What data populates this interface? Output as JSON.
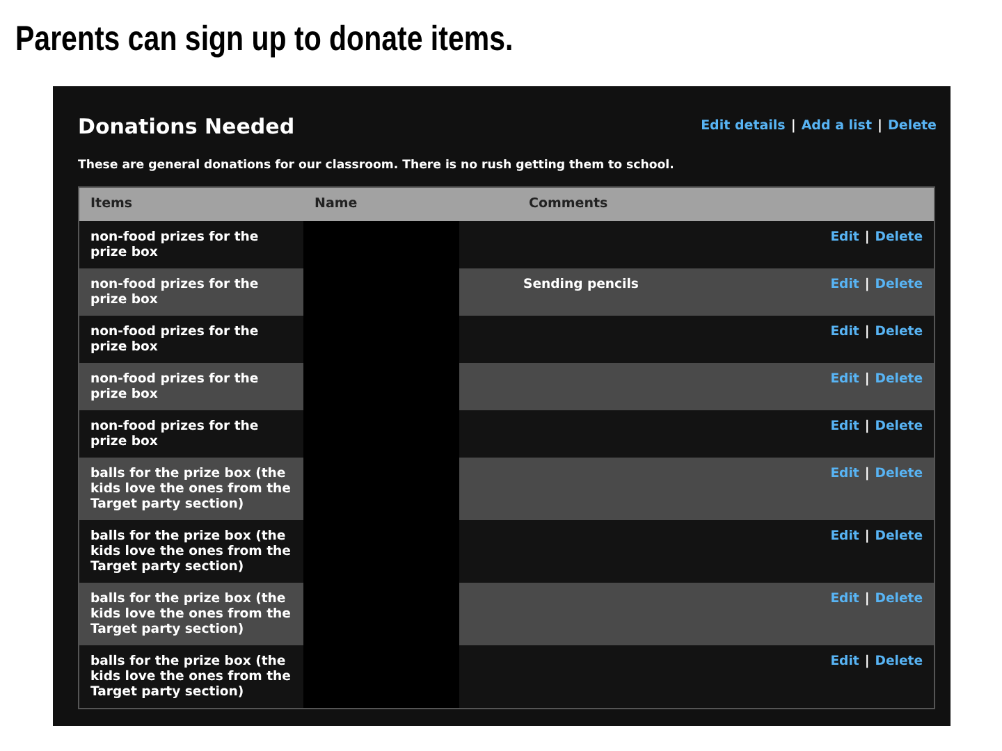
{
  "slide_title": "Parents can sign up to donate items.",
  "panel": {
    "title": "Donations Needed",
    "links": [
      {
        "kind": "link",
        "text": "Edit details"
      },
      {
        "kind": "separator",
        "text": "|"
      },
      {
        "kind": "link",
        "text": "Add a list"
      },
      {
        "kind": "separator",
        "text": "|"
      },
      {
        "kind": "link",
        "text": "Delete"
      }
    ],
    "description": "These are general donations for our classroom. There is no rush getting them to school."
  },
  "table": {
    "columns": [
      "Items",
      "Name",
      "Comments"
    ],
    "rows": [
      {
        "item": "non-food prizes for the prize box",
        "name_redacted": true,
        "comment": "",
        "actions": [
          {
            "kind": "link",
            "text": "Edit"
          },
          {
            "kind": "separator",
            "text": "|"
          },
          {
            "kind": "link",
            "text": "Delete"
          }
        ]
      },
      {
        "item": "non-food prizes for the prize box",
        "name_redacted": true,
        "comment": "Sending pencils",
        "actions": [
          {
            "kind": "link",
            "text": "Edit"
          },
          {
            "kind": "separator",
            "text": "|"
          },
          {
            "kind": "link",
            "text": "Delete"
          }
        ]
      },
      {
        "item": "non-food prizes for the prize box",
        "name_redacted": true,
        "comment": "",
        "actions": [
          {
            "kind": "link",
            "text": "Edit"
          },
          {
            "kind": "separator",
            "text": "|"
          },
          {
            "kind": "link",
            "text": "Delete"
          }
        ]
      },
      {
        "item": "non-food prizes for the prize box",
        "name_redacted": true,
        "comment": "",
        "actions": [
          {
            "kind": "link",
            "text": "Edit"
          },
          {
            "kind": "separator",
            "text": "|"
          },
          {
            "kind": "link",
            "text": "Delete"
          }
        ]
      },
      {
        "item": "non-food prizes for the prize box",
        "name_redacted": true,
        "comment": "",
        "actions": [
          {
            "kind": "link",
            "text": "Edit"
          },
          {
            "kind": "separator",
            "text": "|"
          },
          {
            "kind": "link",
            "text": "Delete"
          }
        ]
      },
      {
        "item": "balls for the prize box (the kids love the ones from the Target party section)",
        "name_redacted": true,
        "comment": "",
        "actions": [
          {
            "kind": "link",
            "text": "Edit"
          },
          {
            "kind": "separator",
            "text": "|"
          },
          {
            "kind": "link",
            "text": "Delete"
          }
        ]
      },
      {
        "item": "balls for the prize box (the kids love the ones from the Target party section)",
        "name_redacted": true,
        "comment": "",
        "actions": [
          {
            "kind": "link",
            "text": "Edit"
          },
          {
            "kind": "separator",
            "text": "|"
          },
          {
            "kind": "link",
            "text": "Delete"
          }
        ]
      },
      {
        "item": "balls for the prize box (the kids love the ones from the Target party section)",
        "name_redacted": true,
        "comment": "",
        "actions": [
          {
            "kind": "link",
            "text": "Edit"
          },
          {
            "kind": "separator",
            "text": "|"
          },
          {
            "kind": "link",
            "text": "Delete"
          }
        ]
      },
      {
        "item": "balls for the prize box (the kids love the ones from the Target party section)",
        "name_redacted": true,
        "comment": "",
        "actions": [
          {
            "kind": "link",
            "text": "Edit"
          },
          {
            "kind": "separator",
            "text": "|"
          },
          {
            "kind": "link",
            "text": "Delete"
          }
        ]
      }
    ]
  }
}
